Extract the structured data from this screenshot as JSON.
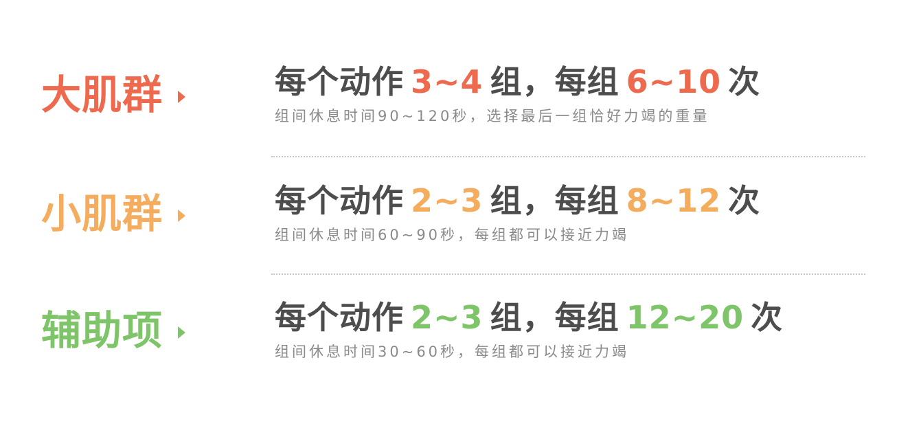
{
  "rows": [
    {
      "label": "大肌群",
      "color": "#ee6a4f",
      "head_prefix": "每个动作",
      "sets": "3~4",
      "head_mid": "组，每组",
      "reps": "6~10",
      "head_suffix": "次",
      "note": "组间休息时间90~120秒，选择最后一组恰好力竭的重量"
    },
    {
      "label": "小肌群",
      "color": "#f4ac5e",
      "head_prefix": "每个动作",
      "sets": "2~3",
      "head_mid": "组，每组",
      "reps": "8~12",
      "head_suffix": "次",
      "note": "组间休息时间60~90秒，每组都可以接近力竭"
    },
    {
      "label": "辅助项",
      "color": "#7ec468",
      "head_prefix": "每个动作",
      "sets": "2~3",
      "head_mid": "组，每组",
      "reps": "12~20",
      "head_suffix": "次",
      "note": "组间休息时间30~60秒，每组都可以接近力竭"
    }
  ],
  "icons": {
    "row_marker": "chevron-right-icon"
  },
  "colors": {
    "text_dark": "#4d4d4d",
    "text_muted": "#8a8a8a",
    "divider": "#c8c8c8"
  }
}
